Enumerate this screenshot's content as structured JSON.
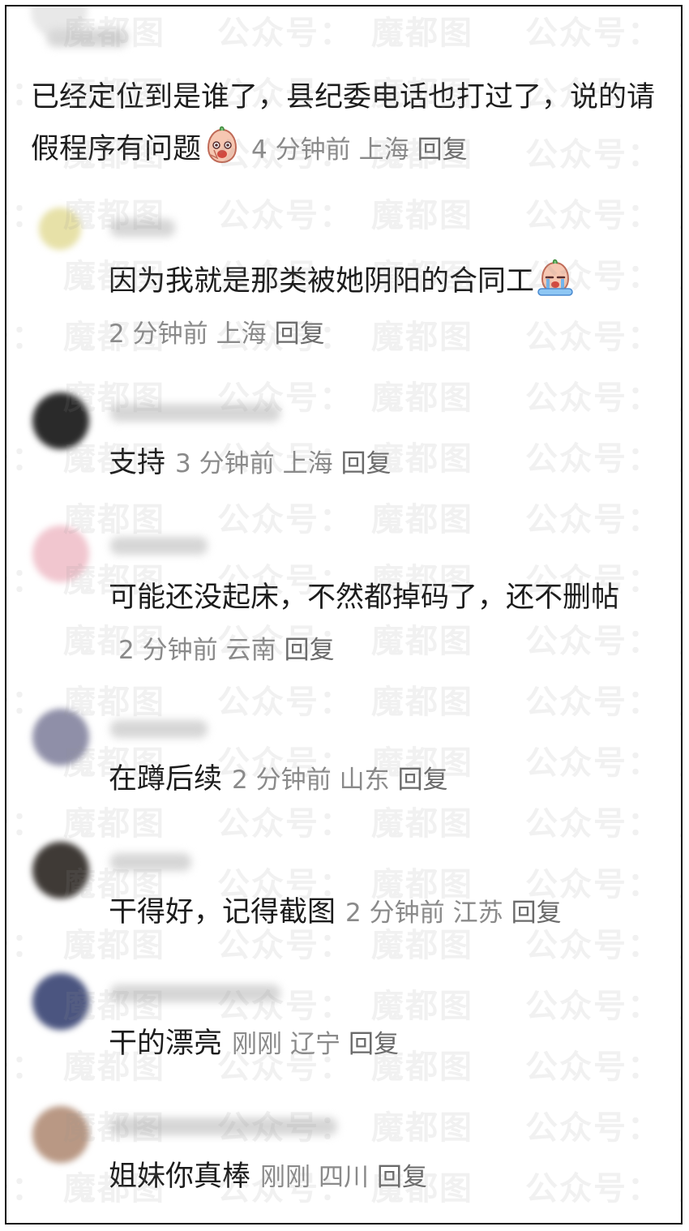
{
  "watermark": "魔都图 公众号：",
  "comments": [
    {
      "text": "已经定位到是谁了，县纪委电话也打过了，说的请假程序有问题",
      "emoji": "peach-face-laughing-icon",
      "time": "4 分钟前",
      "location": "上海",
      "reply": "回复"
    },
    {
      "text": "因为我就是那类被她阴阳的合同工",
      "emoji": "peach-face-crying-icon",
      "time": "2 分钟前",
      "location": "上海",
      "reply": "回复"
    },
    {
      "text": "支持",
      "time": "3 分钟前",
      "location": "上海",
      "reply": "回复"
    },
    {
      "text": "可能还没起床，不然都掉码了，还不删帖",
      "time": "2 分钟前",
      "location": "云南",
      "reply": "回复"
    },
    {
      "text": "在蹲后续",
      "time": "2 分钟前",
      "location": "山东",
      "reply": "回复"
    },
    {
      "text": "干得好，记得截图",
      "time": "2 分钟前",
      "location": "江苏",
      "reply": "回复"
    },
    {
      "text": "干的漂亮",
      "time": "刚刚",
      "location": "辽宁",
      "reply": "回复"
    },
    {
      "text": "姐妹你真棒",
      "time": "刚刚",
      "location": "四川",
      "reply": "回复"
    }
  ],
  "colors": {
    "text": "#1c1c1c",
    "meta": "#8a8a8a",
    "watermark": "#969696"
  }
}
